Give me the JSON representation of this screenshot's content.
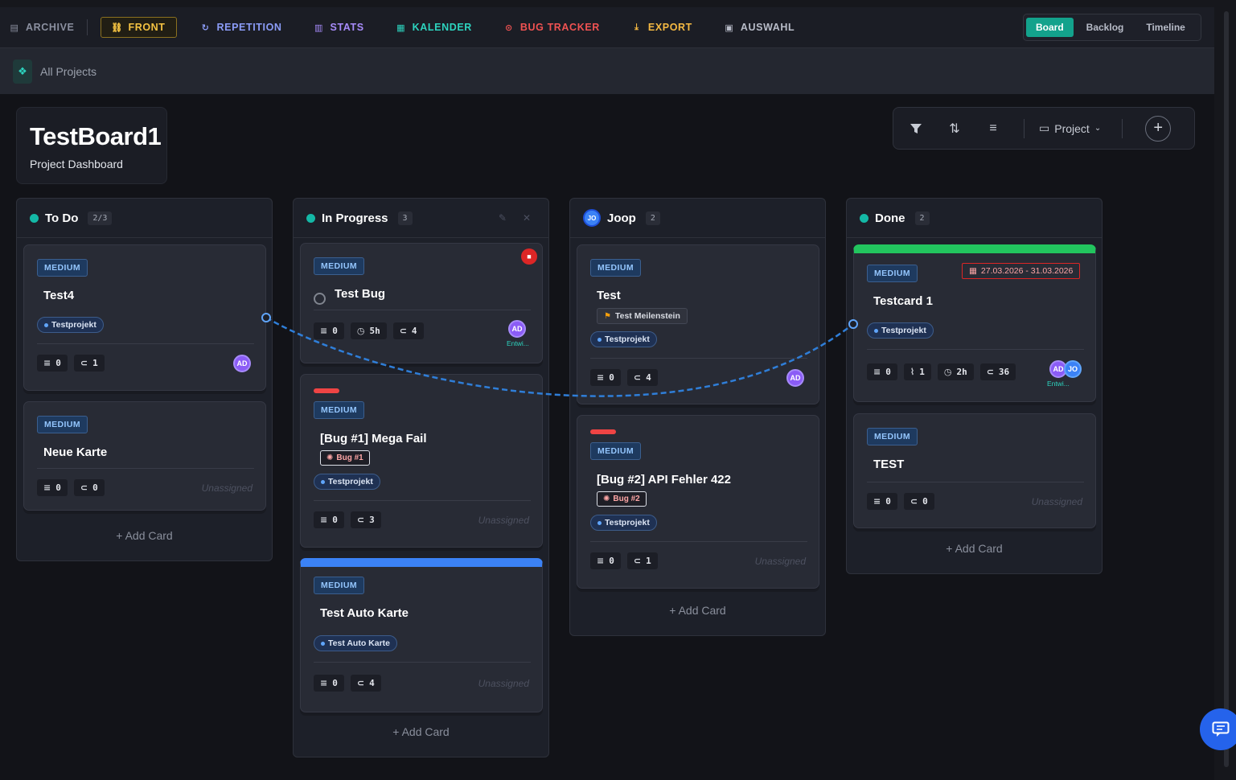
{
  "nav": {
    "archive": "ARCHIVE",
    "front": "FRONT",
    "repetition": "REPETITION",
    "stats": "STATS",
    "kalender": "KALENDER",
    "bugtracker": "BUG TRACKER",
    "export": "EXPORT",
    "auswahl": "AUSWAHL",
    "views": [
      "Board",
      "Backlog",
      "Timeline"
    ],
    "colors": {
      "archive": "#8b90a0",
      "front": "#f5c342",
      "repetition": "#8b9cf7",
      "stats": "#a78bfa",
      "kalender": "#2dd4bf",
      "bugtracker": "#f05252",
      "export": "#f5b942",
      "auswahl": "#b8bcc8"
    }
  },
  "breadcrumb": {
    "label": "All Projects"
  },
  "board": {
    "title": "TestBoard1",
    "subtitle": "Project Dashboard"
  },
  "toolbar": {
    "project_label": "Project",
    "add": "+"
  },
  "columns": [
    {
      "title": "To Do",
      "count": "2/3",
      "add_label": "+ Add Card",
      "cards": [
        {
          "priority": "MEDIUM",
          "title": "Test4",
          "tag": "Testprojekt",
          "m1": "0",
          "m2": "1",
          "avatar": "AD"
        },
        {
          "priority": "MEDIUM",
          "title": "Neue Karte",
          "m1": "0",
          "m2": "0",
          "unassigned": "Unassigned"
        }
      ]
    },
    {
      "title": "In Progress",
      "count": "3",
      "add_label": "+ Add Card",
      "cards": [
        {
          "priority": "MEDIUM",
          "title": "Test Bug",
          "m1": "0",
          "time": "5h",
          "m2": "4",
          "avatar": "AD",
          "role": "Entwi..."
        },
        {
          "priority": "MEDIUM",
          "title": "[Bug #1] Mega Fail",
          "bug": "Bug #1",
          "tag": "Testprojekt",
          "m1": "0",
          "m2": "3",
          "unassigned": "Unassigned"
        },
        {
          "priority": "MEDIUM",
          "title": "Test Auto Karte",
          "tag": "Test Auto Karte",
          "m1": "0",
          "m2": "4",
          "unassigned": "Unassigned"
        }
      ]
    },
    {
      "title": "Joop",
      "avatar": "JO",
      "count": "2",
      "add_label": "+ Add Card",
      "cards": [
        {
          "priority": "MEDIUM",
          "title": "Test",
          "milestone": "Test Meilenstein",
          "tag": "Testprojekt",
          "m1": "0",
          "m2": "4",
          "avatar": "AD"
        },
        {
          "priority": "MEDIUM",
          "title": "[Bug #2] API Fehler 422",
          "bug": "Bug #2",
          "tag": "Testprojekt",
          "m1": "0",
          "m2": "1",
          "unassigned": "Unassigned"
        }
      ]
    },
    {
      "title": "Done",
      "count": "2",
      "add_label": "+ Add Card",
      "cards": [
        {
          "priority": "MEDIUM",
          "title": "Testcard 1",
          "date": "27.03.2026 - 31.03.2026",
          "tag": "Testprojekt",
          "m1": "0",
          "attach": "1",
          "time": "2h",
          "m2": "36",
          "avatar": "AD",
          "avatar2": "JO",
          "role": "Entwi..."
        },
        {
          "priority": "MEDIUM",
          "title": "TEST",
          "m1": "0",
          "m2": "0",
          "unassigned": "Unassigned"
        }
      ]
    }
  ]
}
